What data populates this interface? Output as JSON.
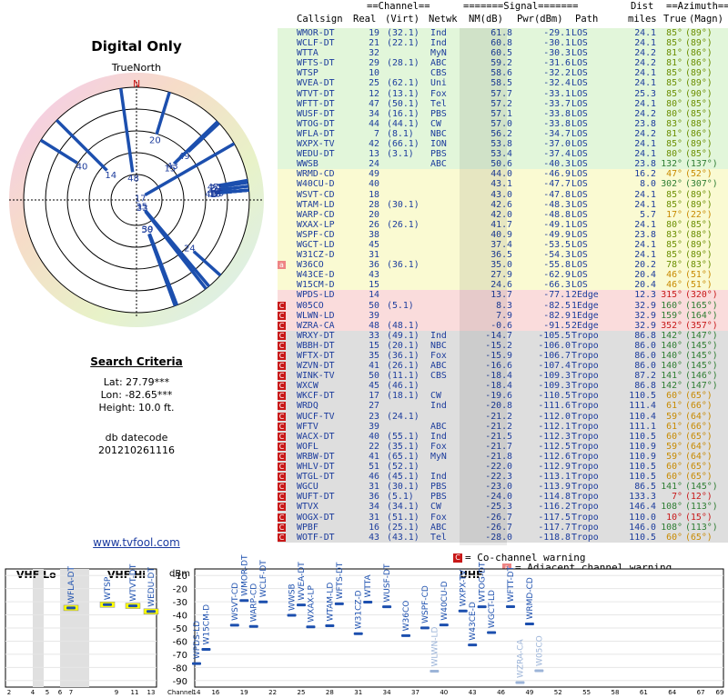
{
  "left_panel": {
    "title": "Digital Only",
    "north_label": "TrueNorth",
    "north_marker": "N",
    "search_title": "Search Criteria",
    "lat": "Lat: 27.79***",
    "lon": "Lon: -82.65***",
    "height": "Height: 10.0 ft.",
    "db_label": "db datecode",
    "db_code": "201210261116",
    "link": "www.tvfool.com"
  },
  "table_header": {
    "group_channel": "==Channel==",
    "group_signal": "=======Signal=======",
    "group_dist": "Dist",
    "group_azimuth": "==Azimuth==",
    "col_callsign": "Callsign",
    "col_real": "Real",
    "col_virt": "(Virt)",
    "col_netwk": "Netwk",
    "col_nm": "NM(dB)",
    "col_pwr": "Pwr(dBm)",
    "col_path": "Path",
    "col_miles": "miles",
    "col_true": "True",
    "col_magn": "(Magn)"
  },
  "colors": {
    "green": "#e2f6da",
    "yellow": "#fafad2",
    "pink": "#fadcdc",
    "gray": "#dedede",
    "co_warn": "#c81818",
    "adj_warn": "#ee8484",
    "text": "#1c3c9c",
    "plot_marker": "#1c4fae",
    "plot_warn_marker": "#9cb4d8",
    "highlight": "#ffff00"
  },
  "legend": {
    "co_channel_label": "= Co-channel warning",
    "adjacent_label": "= Adjacent channel warning",
    "co_mark": "C",
    "adj_mark": "a"
  },
  "chart_data": [
    {
      "type": "table",
      "columns": [
        "Callsign",
        "Real",
        "Virt",
        "Netwk",
        "NM(dB)",
        "Pwr(dBm)",
        "Path",
        "Dist miles",
        "Azimuth True",
        "Azimuth Magn",
        "Band",
        "Warning"
      ],
      "rows": [
        [
          "WMOR-DT",
          "19",
          "32.1",
          "Ind",
          "61.8",
          "-29.1",
          "LOS",
          "24.1",
          "85°",
          "89°",
          "green",
          ""
        ],
        [
          "WCLF-DT",
          "21",
          "22.1",
          "Ind",
          "60.8",
          "-30.1",
          "LOS",
          "24.1",
          "85°",
          "89°",
          "green",
          ""
        ],
        [
          "WTTA",
          "32",
          "",
          "MyN",
          "60.5",
          "-30.3",
          "LOS",
          "24.2",
          "81°",
          "86°",
          "green",
          ""
        ],
        [
          "WFTS-DT",
          "29",
          "28.1",
          "ABC",
          "59.2",
          "-31.6",
          "LOS",
          "24.2",
          "81°",
          "86°",
          "green",
          ""
        ],
        [
          "WTSP",
          "10",
          "",
          "CBS",
          "58.6",
          "-32.2",
          "LOS",
          "24.1",
          "85°",
          "89°",
          "green",
          ""
        ],
        [
          "WVEA-DT",
          "25",
          "62.1",
          "Uni",
          "58.5",
          "-32.4",
          "LOS",
          "24.1",
          "85°",
          "89°",
          "green",
          ""
        ],
        [
          "WTVT-DT",
          "12",
          "13.1",
          "Fox",
          "57.7",
          "-33.1",
          "LOS",
          "25.3",
          "85°",
          "90°",
          "green",
          ""
        ],
        [
          "WFTT-DT",
          "47",
          "50.1",
          "Tel",
          "57.2",
          "-33.7",
          "LOS",
          "24.1",
          "80°",
          "85°",
          "green",
          ""
        ],
        [
          "WUSF-DT",
          "34",
          "16.1",
          "PBS",
          "57.1",
          "-33.8",
          "LOS",
          "24.2",
          "80°",
          "85°",
          "green",
          ""
        ],
        [
          "WTOG-DT",
          "44",
          "44.1",
          "CW",
          "57.0",
          "-33.8",
          "LOS",
          "23.8",
          "83°",
          "88°",
          "green",
          ""
        ],
        [
          "WFLA-DT",
          "7",
          "8.1",
          "NBC",
          "56.2",
          "-34.7",
          "LOS",
          "24.2",
          "81°",
          "86°",
          "green",
          ""
        ],
        [
          "WXPX-TV",
          "42",
          "66.1",
          "ION",
          "53.8",
          "-37.0",
          "LOS",
          "24.1",
          "85°",
          "89°",
          "green",
          ""
        ],
        [
          "WEDU-DT",
          "13",
          "3.1",
          "PBS",
          "53.4",
          "-37.4",
          "LOS",
          "24.1",
          "80°",
          "85°",
          "green",
          ""
        ],
        [
          "WWSB",
          "24",
          "",
          "ABC",
          "50.6",
          "-40.3",
          "LOS",
          "23.8",
          "132°",
          "137°",
          "green",
          ""
        ],
        [
          "WRMD-CD",
          "49",
          "",
          "",
          "44.0",
          "-46.9",
          "LOS",
          "16.2",
          "47°",
          "52°",
          "yellow",
          ""
        ],
        [
          "W40CU-D",
          "40",
          "",
          "",
          "43.1",
          "-47.7",
          "LOS",
          "8.0",
          "302°",
          "307°",
          "yellow",
          ""
        ],
        [
          "WSVT-CD",
          "18",
          "",
          "",
          "43.0",
          "-47.8",
          "LOS",
          "24.1",
          "85°",
          "89°",
          "yellow",
          ""
        ],
        [
          "WTAM-LD",
          "28",
          "30.1",
          "",
          "42.6",
          "-48.3",
          "LOS",
          "24.1",
          "85°",
          "89°",
          "yellow",
          ""
        ],
        [
          "WARP-CD",
          "20",
          "",
          "",
          "42.0",
          "-48.8",
          "LOS",
          "5.7",
          "17°",
          "22°",
          "yellow",
          ""
        ],
        [
          "WXAX-LP",
          "26",
          "26.1",
          "",
          "41.7",
          "-49.1",
          "LOS",
          "24.1",
          "80°",
          "85°",
          "yellow",
          ""
        ],
        [
          "WSPF-CD",
          "38",
          "",
          "",
          "40.9",
          "-49.9",
          "LOS",
          "23.8",
          "83°",
          "88°",
          "yellow",
          ""
        ],
        [
          "WGCT-LD",
          "45",
          "",
          "",
          "37.4",
          "-53.5",
          "LOS",
          "24.1",
          "85°",
          "89°",
          "yellow",
          ""
        ],
        [
          "W31CZ-D",
          "31",
          "",
          "",
          "36.5",
          "-54.3",
          "LOS",
          "24.1",
          "85°",
          "89°",
          "yellow",
          ""
        ],
        [
          "W36CO",
          "36",
          "36.1",
          "",
          "35.0",
          "-55.8",
          "LOS",
          "20.2",
          "78°",
          "83°",
          "yellow",
          "a"
        ],
        [
          "W43CE-D",
          "43",
          "",
          "",
          "27.9",
          "-62.9",
          "LOS",
          "20.4",
          "46°",
          "51°",
          "yellow",
          ""
        ],
        [
          "W15CM-D",
          "15",
          "",
          "",
          "24.6",
          "-66.3",
          "LOS",
          "20.4",
          "46°",
          "51°",
          "yellow",
          ""
        ],
        [
          "WPDS-LD",
          "14",
          "",
          "",
          "13.7",
          "-77.1",
          "2Edge",
          "12.3",
          "315°",
          "320°",
          "pink",
          ""
        ],
        [
          "W05CO",
          "50",
          "5.1",
          "",
          "8.3",
          "-82.5",
          "1Edge",
          "32.9",
          "160°",
          "165°",
          "pink",
          "C"
        ],
        [
          "WLWN-LD",
          "39",
          "",
          "",
          "7.9",
          "-82.9",
          "1Edge",
          "32.9",
          "159°",
          "164°",
          "pink",
          "C"
        ],
        [
          "WZRA-CA",
          "48",
          "48.1",
          "",
          "-0.6",
          "-91.5",
          "2Edge",
          "32.9",
          "352°",
          "357°",
          "pink",
          "C"
        ],
        [
          "WRXY-DT",
          "33",
          "49.1",
          "Ind",
          "-14.7",
          "-105.5",
          "Tropo",
          "86.8",
          "142°",
          "147°",
          "gray",
          "C"
        ],
        [
          "WBBH-DT",
          "15",
          "20.1",
          "NBC",
          "-15.2",
          "-106.0",
          "Tropo",
          "86.0",
          "140°",
          "145°",
          "gray",
          "C"
        ],
        [
          "WFTX-DT",
          "35",
          "36.1",
          "Fox",
          "-15.9",
          "-106.7",
          "Tropo",
          "86.0",
          "140°",
          "145°",
          "gray",
          "C"
        ],
        [
          "WZVN-DT",
          "41",
          "26.1",
          "ABC",
          "-16.6",
          "-107.4",
          "Tropo",
          "86.0",
          "140°",
          "145°",
          "gray",
          "C"
        ],
        [
          "WINK-TV",
          "50",
          "11.1",
          "CBS",
          "-18.4",
          "-109.3",
          "Tropo",
          "87.2",
          "141°",
          "146°",
          "gray",
          "C"
        ],
        [
          "WXCW",
          "45",
          "46.1",
          "",
          "-18.4",
          "-109.3",
          "Tropo",
          "86.8",
          "142°",
          "147°",
          "gray",
          "C"
        ],
        [
          "WKCF-DT",
          "17",
          "18.1",
          "CW",
          "-19.6",
          "-110.5",
          "Tropo",
          "110.5",
          "60°",
          "65°",
          "gray",
          "C"
        ],
        [
          "WRDQ",
          "27",
          "",
          "Ind",
          "-20.8",
          "-111.6",
          "Tropo",
          "111.4",
          "61°",
          "66°",
          "gray",
          "C"
        ],
        [
          "WUCF-TV",
          "23",
          "24.1",
          "",
          "-21.2",
          "-112.0",
          "Tropo",
          "110.4",
          "59°",
          "64°",
          "gray",
          "C"
        ],
        [
          "WFTV",
          "39",
          "",
          "ABC",
          "-21.2",
          "-112.1",
          "Tropo",
          "111.1",
          "61°",
          "66°",
          "gray",
          "C"
        ],
        [
          "WACX-DT",
          "40",
          "55.1",
          "Ind",
          "-21.5",
          "-112.3",
          "Tropo",
          "110.5",
          "60°",
          "65°",
          "gray",
          "C"
        ],
        [
          "WOFL",
          "22",
          "35.1",
          "Fox",
          "-21.7",
          "-112.5",
          "Tropo",
          "110.9",
          "59°",
          "64°",
          "gray",
          "C"
        ],
        [
          "WRBW-DT",
          "41",
          "65.1",
          "MyN",
          "-21.8",
          "-112.6",
          "Tropo",
          "110.9",
          "59°",
          "64°",
          "gray",
          "C"
        ],
        [
          "WHLV-DT",
          "51",
          "52.1",
          "",
          "-22.0",
          "-112.9",
          "Tropo",
          "110.5",
          "60°",
          "65°",
          "gray",
          "C"
        ],
        [
          "WTGL-DT",
          "46",
          "45.1",
          "Ind",
          "-22.3",
          "-113.1",
          "Tropo",
          "110.5",
          "60°",
          "65°",
          "gray",
          "C"
        ],
        [
          "WGCU",
          "31",
          "30.1",
          "PBS",
          "-23.0",
          "-113.9",
          "Tropo",
          "86.5",
          "141°",
          "145°",
          "gray",
          "C"
        ],
        [
          "WUFT-DT",
          "36",
          "5.1",
          "PBS",
          "-24.0",
          "-114.8",
          "Tropo",
          "133.3",
          "7°",
          "12°",
          "gray",
          "C"
        ],
        [
          "WTVX",
          "34",
          "34.1",
          "CW",
          "-25.3",
          "-116.2",
          "Tropo",
          "146.4",
          "108°",
          "113°",
          "gray",
          "C"
        ],
        [
          "WOGX-DT",
          "31",
          "51.1",
          "Fox",
          "-26.7",
          "-117.5",
          "Tropo",
          "110.0",
          "10°",
          "15°",
          "gray",
          "C"
        ],
        [
          "WPBF",
          "16",
          "25.1",
          "ABC",
          "-26.7",
          "-117.7",
          "Tropo",
          "146.0",
          "108°",
          "113°",
          "gray",
          "C"
        ],
        [
          "WOTF-DT",
          "43",
          "43.1",
          "Tel",
          "-28.0",
          "-118.8",
          "Tropo",
          "110.5",
          "60°",
          "65°",
          "gray",
          "C"
        ]
      ]
    },
    {
      "type": "scatter",
      "title": "",
      "xlabel": "Channel",
      "ylabel": "dBm",
      "ylim": [
        -95,
        -5
      ],
      "y_ticks": [
        -10,
        -20,
        -30,
        -40,
        -50,
        -60,
        -70,
        -80,
        -90
      ],
      "vhf_lo_label": "VHF Lo",
      "vhf_hi_label": "VHF Hi",
      "uhf_label": "UHF",
      "vhf_ticks": [
        2,
        4,
        5,
        6,
        7,
        9,
        11,
        13
      ],
      "uhf_ticks": [
        14,
        16,
        19,
        22,
        25,
        28,
        31,
        34,
        37,
        40,
        43,
        46,
        49,
        52,
        55,
        58,
        61,
        64,
        67,
        69
      ],
      "points": [
        {
          "label": "WFLA-DT",
          "ch": 7,
          "dbm": -34.7,
          "band": "vhf",
          "hl": true
        },
        {
          "label": "WTSP",
          "ch": 10,
          "dbm": -32.2,
          "band": "vhf",
          "hl": true
        },
        {
          "label": "WTVT-DT",
          "ch": 12,
          "dbm": -33.1,
          "band": "vhf",
          "hl": true
        },
        {
          "label": "WEDU-DT",
          "ch": 13,
          "dbm": -37.4,
          "band": "vhf",
          "hl": true
        },
        {
          "label": "WPDS-LD",
          "ch": 14,
          "dbm": -77.1,
          "band": "uhf"
        },
        {
          "label": "W15CM-D",
          "ch": 15,
          "dbm": -66.3,
          "band": "uhf"
        },
        {
          "label": "WSVT-CD",
          "ch": 18,
          "dbm": -47.8,
          "band": "uhf"
        },
        {
          "label": "WMOR-DT",
          "ch": 19,
          "dbm": -29.1,
          "band": "uhf"
        },
        {
          "label": "WARP-CD",
          "ch": 20,
          "dbm": -48.8,
          "band": "uhf"
        },
        {
          "label": "WCLF-DT",
          "ch": 21,
          "dbm": -30.1,
          "band": "uhf"
        },
        {
          "label": "WWSB",
          "ch": 24,
          "dbm": -40.3,
          "band": "uhf"
        },
        {
          "label": "WVEA-DT",
          "ch": 25,
          "dbm": -32.4,
          "band": "uhf"
        },
        {
          "label": "WXAX-LP",
          "ch": 26,
          "dbm": -49.1,
          "band": "uhf"
        },
        {
          "label": "WTAM-LD",
          "ch": 28,
          "dbm": -48.3,
          "band": "uhf"
        },
        {
          "label": "WFTS-DT",
          "ch": 29,
          "dbm": -31.6,
          "band": "uhf"
        },
        {
          "label": "W31CZ-D",
          "ch": 31,
          "dbm": -54.3,
          "band": "uhf"
        },
        {
          "label": "WTTA",
          "ch": 32,
          "dbm": -30.3,
          "band": "uhf"
        },
        {
          "label": "WUSF-DT",
          "ch": 34,
          "dbm": -33.8,
          "band": "uhf"
        },
        {
          "label": "W36CO",
          "ch": 36,
          "dbm": -55.8,
          "band": "uhf"
        },
        {
          "label": "WSPF-CD",
          "ch": 38,
          "dbm": -49.9,
          "band": "uhf"
        },
        {
          "label": "WLWN-LD",
          "ch": 39,
          "dbm": -82.9,
          "band": "uhf",
          "warn": true
        },
        {
          "label": "W40CU-D",
          "ch": 40,
          "dbm": -47.7,
          "band": "uhf"
        },
        {
          "label": "WXPX-TV",
          "ch": 42,
          "dbm": -37.0,
          "band": "uhf"
        },
        {
          "label": "W43CE-D",
          "ch": 43,
          "dbm": -62.9,
          "band": "uhf"
        },
        {
          "label": "WTOG-DT",
          "ch": 44,
          "dbm": -33.8,
          "band": "uhf"
        },
        {
          "label": "WGCT-LD",
          "ch": 45,
          "dbm": -53.5,
          "band": "uhf"
        },
        {
          "label": "WFTT-DT",
          "ch": 47,
          "dbm": -33.7,
          "band": "uhf"
        },
        {
          "label": "WZRA-CA",
          "ch": 48,
          "dbm": -91.5,
          "band": "uhf",
          "warn": true
        },
        {
          "label": "WRMD-CD",
          "ch": 49,
          "dbm": -46.9,
          "band": "uhf"
        },
        {
          "label": "W05CO",
          "ch": 50,
          "dbm": -82.5,
          "band": "uhf",
          "warn": true
        }
      ]
    },
    {
      "type": "polar",
      "north_up": true,
      "azimuths": [
        {
          "label": "48",
          "az": 352,
          "nm": -0.6
        },
        {
          "label": "40",
          "az": 302,
          "nm": 43.1
        },
        {
          "label": "14",
          "az": 315,
          "nm": 13.7
        },
        {
          "label": "20",
          "az": 17,
          "nm": 42.0
        },
        {
          "label": "49",
          "az": 47,
          "nm": 44.0
        },
        {
          "label": "43",
          "az": 46,
          "nm": 27.9
        },
        {
          "label": "15",
          "az": 46,
          "nm": 24.6
        },
        {
          "label": "17",
          "az": 60,
          "nm": -19.6
        },
        {
          "label": "47",
          "az": 80,
          "nm": 57.2
        },
        {
          "label": "44",
          "az": 83,
          "nm": 57.0
        },
        {
          "label": "42",
          "az": 85,
          "nm": 53.8
        },
        {
          "label": "19",
          "az": 85,
          "nm": 61.8
        },
        {
          "label": "32",
          "az": 81,
          "nm": 60.5
        },
        {
          "label": "29",
          "az": 81,
          "nm": 59.2
        },
        {
          "label": "10",
          "az": 85,
          "nm": 58.6
        },
        {
          "label": "25",
          "az": 85,
          "nm": 58.5
        },
        {
          "label": "12",
          "az": 85,
          "nm": 57.7
        },
        {
          "label": "24",
          "az": 132,
          "nm": 50.6
        },
        {
          "label": "33",
          "az": 142,
          "nm": -14.7
        },
        {
          "label": "35",
          "az": 140,
          "nm": -15.9
        },
        {
          "label": "39",
          "az": 159,
          "nm": 7.9
        },
        {
          "label": "50",
          "az": 160,
          "nm": 8.3
        }
      ]
    }
  ]
}
